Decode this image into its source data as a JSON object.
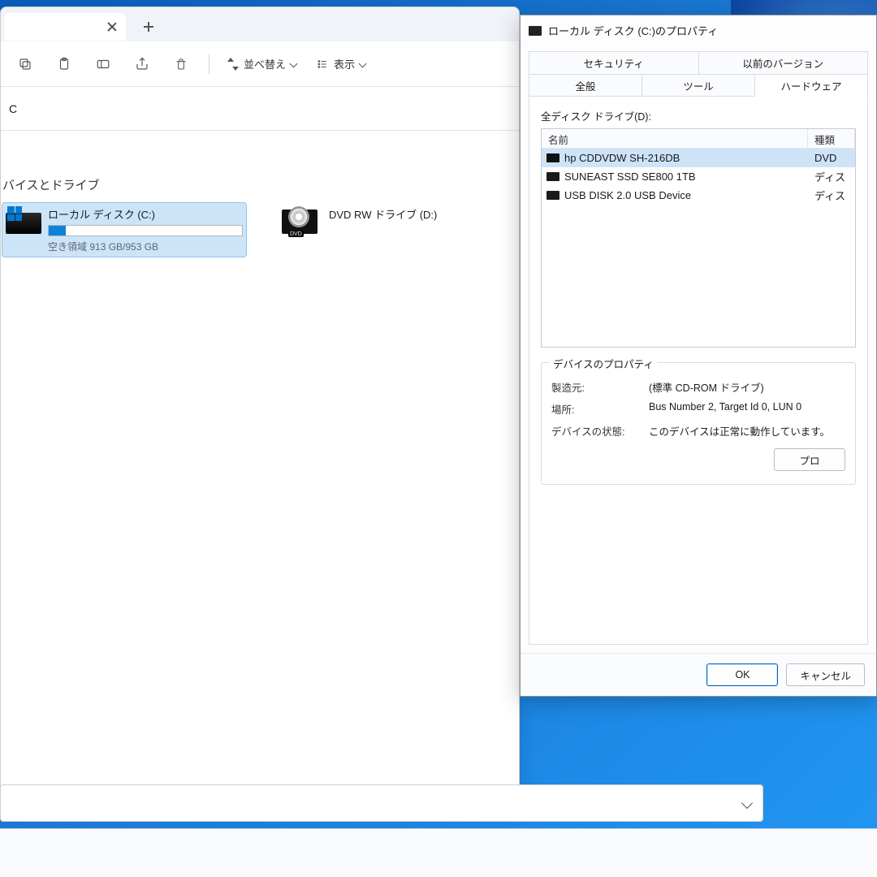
{
  "explorer": {
    "toolbar": {
      "sort_label": "並べ替え",
      "view_label": "表示"
    },
    "addressbar": "C",
    "devices_header": "バイスとドライブ",
    "local_disk": {
      "name": "ローカル ディスク (C:)",
      "free_text": "空き領域 913 GB/953 GB"
    },
    "dvd_drive": {
      "name": "DVD RW ドライブ (D:)",
      "badge": "DVD"
    }
  },
  "properties": {
    "title": "ローカル ディスク (C:)のプロパティ",
    "tabs_row1": [
      "セキュリティ",
      "以前のバージョン"
    ],
    "tabs_row2": [
      "全般",
      "ツール",
      "ハードウェア"
    ],
    "active_tab": "ハードウェア",
    "all_drives_label": "全ディスク ドライブ(D):",
    "columns": {
      "name": "名前",
      "type": "種類"
    },
    "drives": [
      {
        "name": "hp CDDVDW SH-216DB",
        "type": "DVD",
        "selected": true,
        "icon": "dvd"
      },
      {
        "name": "SUNEAST SSD SE800 1TB",
        "type": "ディス",
        "selected": false,
        "icon": "disk"
      },
      {
        "name": "USB DISK 2.0 USB Device",
        "type": "ディス",
        "selected": false,
        "icon": "disk"
      }
    ],
    "device_props_header": "デバイスのプロパティ",
    "kv": {
      "manufacturer_k": "製造元:",
      "manufacturer_v": "(標準 CD-ROM ドライブ)",
      "location_k": "場所:",
      "location_v": "Bus Number 2, Target Id 0, LUN 0",
      "status_k": "デバイスの状態:",
      "status_v": "このデバイスは正常に動作しています。"
    },
    "properties_button": "プロ",
    "ok": "OK",
    "cancel": "キャンセル"
  }
}
